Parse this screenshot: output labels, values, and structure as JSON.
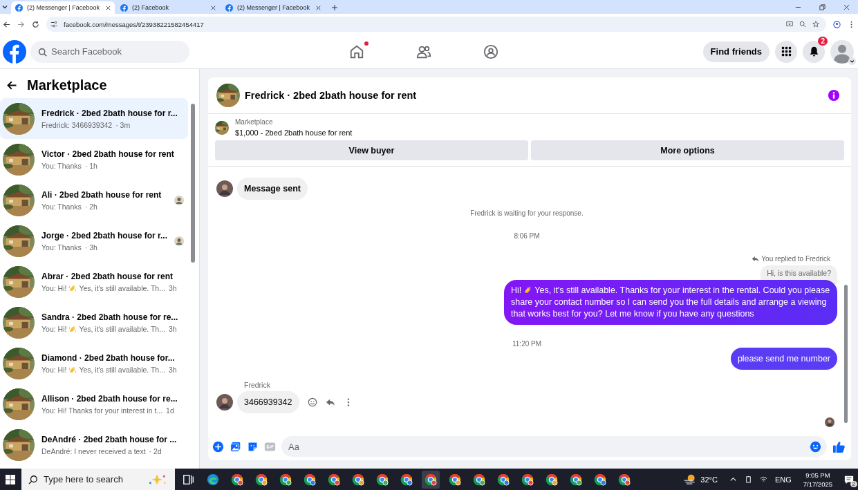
{
  "browser": {
    "tabs": [
      {
        "title": "(2) Messenger | Facebook",
        "selected": true
      },
      {
        "title": "(2) Facebook",
        "selected": false
      },
      {
        "title": "(2) Messenger | Facebook",
        "selected": false
      }
    ],
    "url": "facebook.com/messages/t/23938221582454417"
  },
  "header": {
    "search_placeholder": "Search Facebook",
    "home_dot": true,
    "find_friends": "Find friends",
    "notification_count": "2"
  },
  "sidebar": {
    "title": "Marketplace",
    "conversations": [
      {
        "name": "Fredrick · 2bed 2bath house for r...",
        "preview": "Fredrick: 3466939342",
        "wave": false,
        "time": "· 3m",
        "selected": true,
        "seen": false
      },
      {
        "name": "Victor · 2bed 2bath house for rent",
        "preview": "You: Thanks",
        "wave": false,
        "time": "· 1h",
        "selected": false,
        "seen": false
      },
      {
        "name": "Ali · 2bed 2bath house for rent",
        "preview": "You: Thanks",
        "wave": false,
        "time": "· 2h",
        "selected": false,
        "seen": true
      },
      {
        "name": "Jorge · 2bed 2bath house for r...",
        "preview": "You: Thanks",
        "wave": false,
        "time": "· 3h",
        "selected": false,
        "seen": true
      },
      {
        "name": "Abrar · 2bed 2bath house for rent",
        "preview": "You: Hi!",
        "wave": true,
        "preview_rest": "Yes, it's still available. Th...",
        "time": "3h",
        "selected": false,
        "seen": false
      },
      {
        "name": "Sandra · 2bed 2bath house for re...",
        "preview": "You: Hi!",
        "wave": true,
        "preview_rest": "Yes, it's still available. Th...",
        "time": "3h",
        "selected": false,
        "seen": false
      },
      {
        "name": "Diamond · 2bed 2bath house for...",
        "preview": "You: Hi!",
        "wave": true,
        "preview_rest": "Yes, it's still available. Th...",
        "time": "3h",
        "selected": false,
        "seen": false
      },
      {
        "name": "Allison · 2bed 2bath house for re...",
        "preview": "You: Hi! Thanks for your interest in t...",
        "wave": false,
        "time": "1d",
        "selected": false,
        "seen": false
      },
      {
        "name": "DeAndré · 2bed 2bath house for ...",
        "preview": "DeAndré: I never received a text",
        "wave": false,
        "time": "· 2d",
        "selected": false,
        "seen": false
      }
    ]
  },
  "chat": {
    "title": "Fredrick · 2bed 2bath house for rent",
    "listing_label": "Marketplace",
    "listing": "$1,000 - 2bed 2bath house for rent",
    "buttons": [
      "View buyer",
      "More options"
    ],
    "messages": [
      {
        "kind": "incoming",
        "text": "Message sent",
        "bold": true,
        "actions": false
      },
      {
        "kind": "notice",
        "text": "Fredrick is waiting for your response."
      },
      {
        "kind": "time",
        "text": "8:06 PM"
      },
      {
        "kind": "reply_note",
        "text": "You replied to Fredrick"
      },
      {
        "kind": "quoted",
        "text": "Hi, is this available?"
      },
      {
        "kind": "outgoing",
        "text_before": "Hi!",
        "wave": true,
        "text": "Yes, it's still available. Thanks for your interest in the rental. Could you please share your contact number so I can send you the full details and arrange a viewing that works best for you? Let me know if you have any questions"
      },
      {
        "kind": "time",
        "text": "11:20 PM"
      },
      {
        "kind": "outgoing",
        "wave": false,
        "text": "please send me number"
      },
      {
        "kind": "sender",
        "text": "Fredrick"
      },
      {
        "kind": "incoming",
        "text": "3466939342",
        "bold": false,
        "actions": true
      },
      {
        "kind": "seen"
      }
    ],
    "composer_placeholder": "Aa"
  },
  "taskbar": {
    "search_placeholder": "Type here to search",
    "temperature": "32°C",
    "language": "ENG",
    "time": "9:05 PM",
    "date": "7/17/2025",
    "notification_count": "2"
  }
}
